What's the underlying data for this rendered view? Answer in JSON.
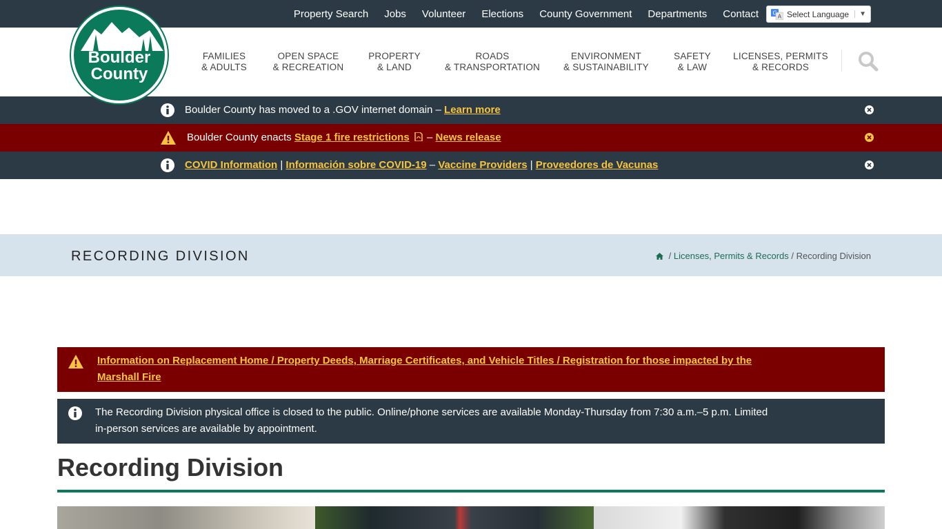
{
  "utility_nav": [
    "Property Search",
    "Jobs",
    "Volunteer",
    "Elections",
    "County Government",
    "Departments",
    "Contact"
  ],
  "language": {
    "label": "Select Language"
  },
  "logo": {
    "line1": "Boulder",
    "line2": "County"
  },
  "main_nav": [
    {
      "line1": "FAMILIES",
      "line2": "& ADULTS"
    },
    {
      "line1": "OPEN SPACE",
      "line2": "& RECREATION"
    },
    {
      "line1": "PROPERTY",
      "line2": "& LAND"
    },
    {
      "line1": "ROADS",
      "line2": "& TRANSPORTATION"
    },
    {
      "line1": "ENVIRONMENT",
      "line2": "& SUSTAINABILITY"
    },
    {
      "line1": "SAFETY",
      "line2": "& LAW"
    },
    {
      "line1": "LICENSES, PERMITS",
      "line2": "& RECORDS"
    }
  ],
  "alerts": {
    "gov": {
      "text": "Boulder County has moved to a .GOV internet domain – ",
      "link": "Learn more"
    },
    "fire": {
      "text": "Boulder County enacts ",
      "link1": "Stage 1 fire restrictions",
      "dash": " – ",
      "link2": "News release"
    },
    "covid": {
      "link1": "COVID Information",
      "sep1": " | ",
      "link2": "Información sobre COVID-19",
      "sep2": " – ",
      "link3": "Vaccine Providers",
      "sep3": " | ",
      "link4": "Proveedores de Vacunas"
    }
  },
  "page": {
    "title_band": "RECORDING DIVISION",
    "breadcrumb": {
      "sep": " / ",
      "section": "Licenses, Permits & Records",
      "current": "Recording Division"
    },
    "notice_red": "Information on Replacement Home / Property Deeds, Marriage Certificates, and Vehicle Titles / Registration for those impacted by the Marshall Fire",
    "notice_info": "The Recording Division physical office is closed to the public. Online/phone services are available Monday-Thursday from 7:30 a.m.–5 p.m. Limited in-person services are available by appointment.",
    "heading": "Recording Division"
  },
  "colors": {
    "dark": "#2b3a45",
    "alert_red": "#7a0000",
    "link_yellow": "#f7c440",
    "brand_green": "#0b7a5b",
    "band": "#d6e3ec"
  }
}
